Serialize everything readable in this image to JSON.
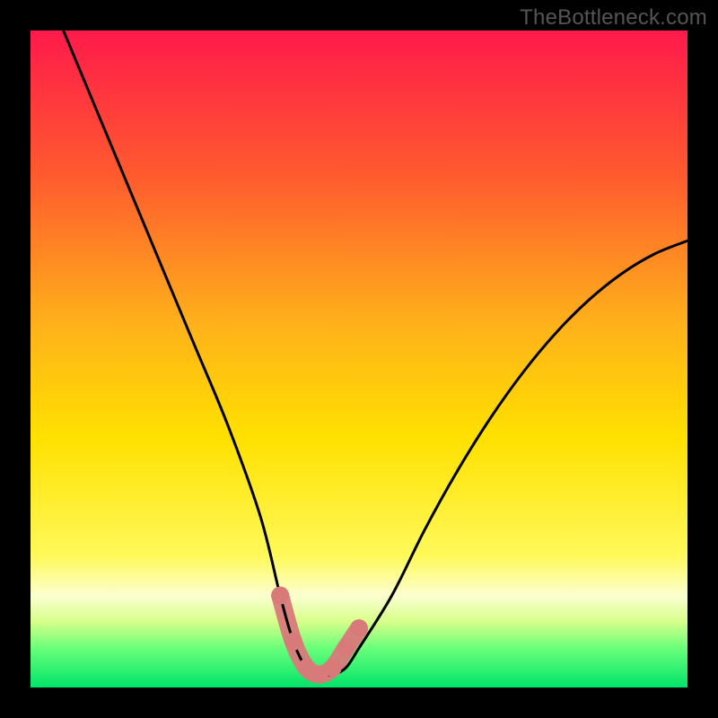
{
  "watermark": "TheBottleneck.com",
  "colors": {
    "top": "#ff1a4b",
    "upper_mid": "#ff8a1f",
    "mid": "#ffe100",
    "lower_mid": "#f7ff4a",
    "pale_band": "#fcffd0",
    "green": "#00e46a",
    "frame": "#000000",
    "curve": "#000000",
    "marker": "#d97a7a"
  },
  "gradient_stops": [
    {
      "pct": 0,
      "color": "#ff1a4b"
    },
    {
      "pct": 22,
      "color": "#ff5a2e"
    },
    {
      "pct": 45,
      "color": "#ffb21a"
    },
    {
      "pct": 62,
      "color": "#ffe100"
    },
    {
      "pct": 80,
      "color": "#fff95a"
    },
    {
      "pct": 86,
      "color": "#fcffd0"
    },
    {
      "pct": 90,
      "color": "#d7ff8a"
    },
    {
      "pct": 94,
      "color": "#6aff7a"
    },
    {
      "pct": 100,
      "color": "#00e46a"
    }
  ],
  "chart_data": {
    "type": "line",
    "title": "",
    "xlabel": "",
    "ylabel": "",
    "xlim": [
      0,
      100
    ],
    "ylim": [
      0,
      100
    ],
    "series": [
      {
        "name": "bottleneck-curve",
        "x": [
          5,
          10,
          15,
          20,
          25,
          30,
          35,
          38,
          40,
          42,
          44,
          46,
          48,
          50,
          55,
          60,
          65,
          70,
          75,
          80,
          85,
          90,
          95,
          100
        ],
        "y": [
          100,
          88,
          76,
          64,
          52,
          40,
          26,
          14,
          7,
          3,
          2,
          2,
          3,
          6,
          14,
          24,
          33,
          41,
          48,
          54,
          59,
          63,
          66,
          68
        ]
      }
    ],
    "markers": {
      "name": "valley-highlight",
      "x": [
        38,
        40,
        42,
        44,
        46,
        48,
        50
      ],
      "y": [
        14,
        7,
        3,
        2,
        3,
        6,
        9
      ]
    }
  }
}
